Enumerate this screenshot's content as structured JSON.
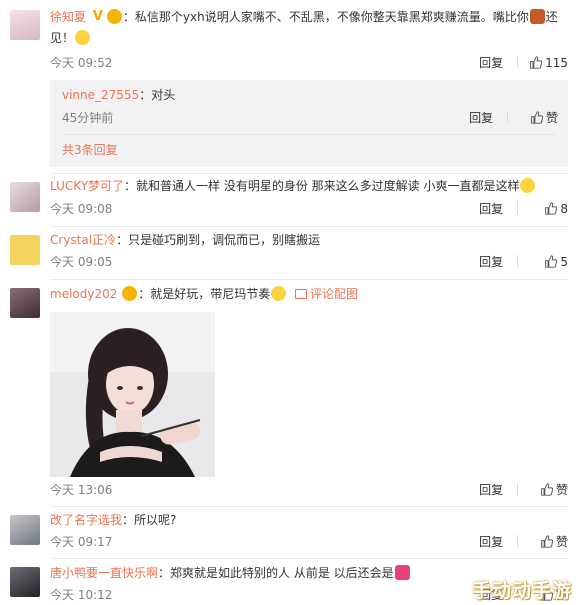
{
  "comments": [
    {
      "username": "徐知夏",
      "badge": "V",
      "level": "😊",
      "text": "：私信那个yxh说明人家嘴不、不乱黑，不像你整天靠黑郑爽赚流量。嘴比你",
      "text_end": "还",
      "text_line2": "见！",
      "time": "今天 09:52",
      "reply": "回复",
      "likes": "115",
      "avatar_color": "#e9d2d8"
    },
    {
      "username": "LUCKY梦可了",
      "text": "：就和普通人一样  没有明星的身份  那来这么多过度解读  小爽一直都是这样",
      "time": "今天 09:08",
      "reply": "回复",
      "likes": "8",
      "avatar_color": "#d7c9cf"
    },
    {
      "username": "Crystal正冷",
      "text": "：只是碰巧刷到，调侃而已，别瞎搬运",
      "time": "今天 09:05",
      "reply": "回复",
      "likes": "5",
      "avatar_color": "#f4d35e"
    },
    {
      "username": "melody202",
      "text": "：就是好玩，带尼玛节奏",
      "pic_link": "评论配图",
      "time": "今天 13:06",
      "reply": "回复",
      "likes": "赞",
      "avatar_color": "#6b4a55"
    },
    {
      "username": "改了名字选我",
      "text": "：所以呢?",
      "time": "今天 09:17",
      "reply": "回复",
      "likes": "赞",
      "avatar_color": "#a0a4a8"
    },
    {
      "username": "唐小鸭要一直快乐啊",
      "text": "：郑爽就是如此特别的人 从前是 以后还会是",
      "time": "今天 10:12",
      "reply": "回复",
      "likes": "赞",
      "avatar_color": "#3e3e44"
    }
  ],
  "sub_reply": {
    "username": "vinne_27555",
    "text": "：对头",
    "time": "45分钟前",
    "reply": "回复",
    "likes": "赞",
    "more": "共3条回复"
  },
  "watermark": "手动动手游"
}
